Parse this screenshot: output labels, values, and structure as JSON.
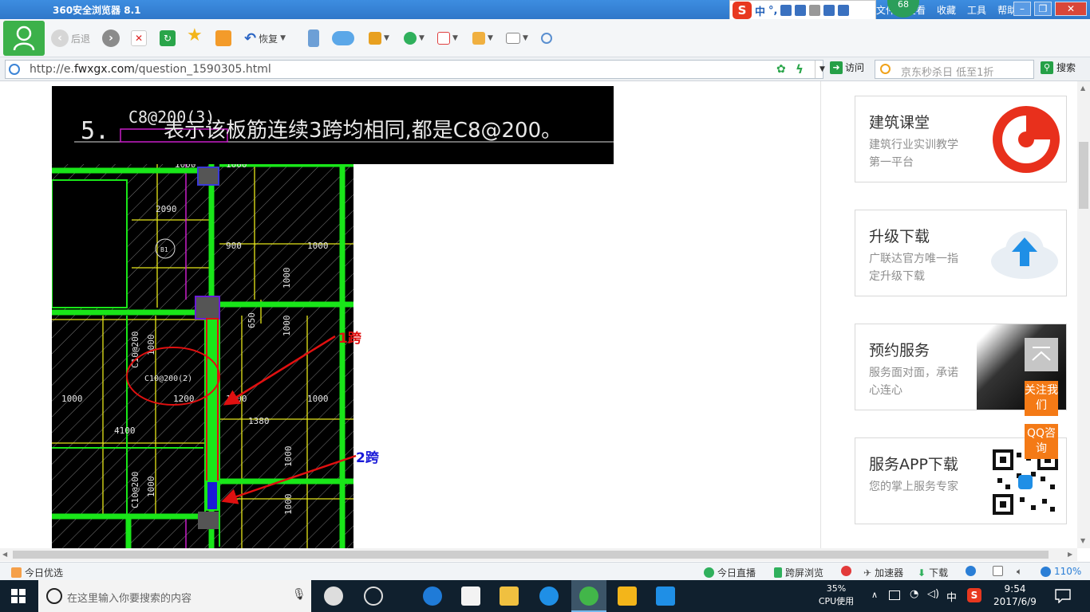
{
  "browser": {
    "title": "360安全浏览器 8.1",
    "top_links": [
      "文件",
      "查看",
      "收藏",
      "工具",
      "帮助"
    ],
    "ime": {
      "chinese_mode": "中",
      "punct": "°,"
    },
    "badge_count": "68"
  },
  "toolbar": {
    "back_label": "后退",
    "restore_label": "恢复"
  },
  "address": {
    "url_prefix": "http://e.",
    "url_host": "fwxgx.com",
    "url_path": "/question_1590305.html",
    "visit_label": "访问",
    "search_placeholder": "京东秒杀日 低至1折",
    "search_label": "搜索"
  },
  "cad": {
    "header_num": "5.",
    "header_code": "C8@200(3)",
    "header_text": "表示该板筋连续3跨均相同,都是C8@200。",
    "labels": {
      "d1000a": "1000",
      "d1000b": "1000",
      "d2090": "2090",
      "d900": "900",
      "d1000c": "1000",
      "d1000v1": "1000",
      "d650": "650",
      "d1000v2": "1000",
      "c10v1": "C10@200",
      "d1000v3": "1000",
      "c10circle": "C10@200(2)",
      "d1000h1": "1000",
      "d1200a": "1200",
      "d1200b": "1200",
      "d1000h2": "1000",
      "d4100": "4100",
      "d1380": "1380",
      "d1000v4": "1000",
      "c10v2": "C10@200",
      "d1000v5": "1000",
      "d1000v6": "1000",
      "b1": "B1"
    },
    "span1_label": "1跨",
    "span2_label": "2跨"
  },
  "sidebar": {
    "cards": [
      {
        "title": "建筑课堂",
        "desc": "建筑行业实训教学第一平台"
      },
      {
        "title": "升级下载",
        "desc": "广联达官方唯一指定升级下载"
      },
      {
        "title": "预约服务",
        "desc": "服务面对面，承诺心连心"
      },
      {
        "title": "服务APP下载",
        "desc": "您的掌上服务专家"
      }
    ],
    "follow_label": "关注我们",
    "qq_label": "QQ咨询"
  },
  "statusbar": {
    "today_picks": "今日优选",
    "live": "今日直播",
    "cross_screen": "跨屏浏览",
    "accelerator": "加速器",
    "download": "下载",
    "zoom": "110%"
  },
  "taskbar": {
    "search_placeholder": "在这里输入你要搜索的内容",
    "cpu_percent": "35%",
    "cpu_label": "CPU使用",
    "ime_char": "中",
    "time": "9:54",
    "date": "2017/6/9"
  },
  "colors": {
    "cad_green": "#19e619",
    "cad_yellow": "#e6e61a",
    "cad_magenta": "#c81ec8",
    "annotation_red": "#e01010",
    "annotation_blue": "#1a1ad8",
    "float_orange": "#f47a16"
  }
}
